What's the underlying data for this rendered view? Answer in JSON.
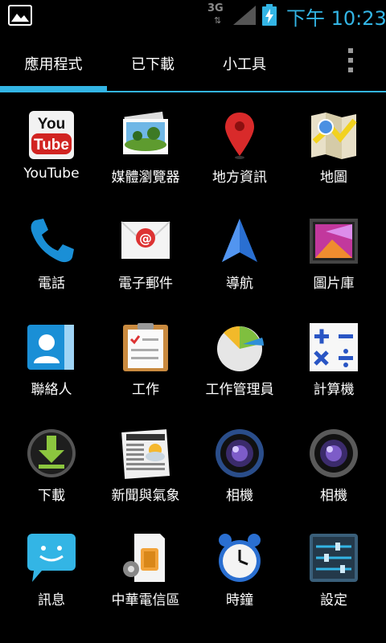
{
  "status_bar": {
    "network": "3G",
    "time": "下午 10:23",
    "icons": [
      "gallery-notification-icon",
      "data-transfer-icon",
      "signal-icon",
      "battery-charging-icon"
    ]
  },
  "tabs": [
    {
      "label": "應用程式",
      "selected": true
    },
    {
      "label": "已下載",
      "selected": false
    },
    {
      "label": "小工具",
      "selected": false
    }
  ],
  "colors": {
    "accent": "#33b5e5",
    "background": "#000000"
  },
  "apps": [
    {
      "label": "YouTube",
      "icon": "youtube-icon"
    },
    {
      "label": "媒體瀏覽器",
      "icon": "media-browser-icon"
    },
    {
      "label": "地方資訊",
      "icon": "places-icon"
    },
    {
      "label": "地圖",
      "icon": "maps-icon"
    },
    {
      "label": "電話",
      "icon": "phone-icon"
    },
    {
      "label": "電子郵件",
      "icon": "email-icon"
    },
    {
      "label": "導航",
      "icon": "navigation-icon"
    },
    {
      "label": "圖片庫",
      "icon": "gallery-icon"
    },
    {
      "label": "聯絡人",
      "icon": "contacts-icon"
    },
    {
      "label": "工作",
      "icon": "tasks-icon"
    },
    {
      "label": "工作管理員",
      "icon": "task-manager-icon"
    },
    {
      "label": "計算機",
      "icon": "calculator-icon"
    },
    {
      "label": "下載",
      "icon": "downloads-icon"
    },
    {
      "label": "新聞與氣象",
      "icon": "news-weather-icon"
    },
    {
      "label": "相機",
      "icon": "camera-icon"
    },
    {
      "label": "相機",
      "icon": "camera-icon"
    },
    {
      "label": "訊息",
      "icon": "messaging-icon"
    },
    {
      "label": "中華電信區",
      "icon": "sim-toolkit-icon"
    },
    {
      "label": "時鐘",
      "icon": "clock-icon"
    },
    {
      "label": "設定",
      "icon": "settings-icon"
    }
  ]
}
